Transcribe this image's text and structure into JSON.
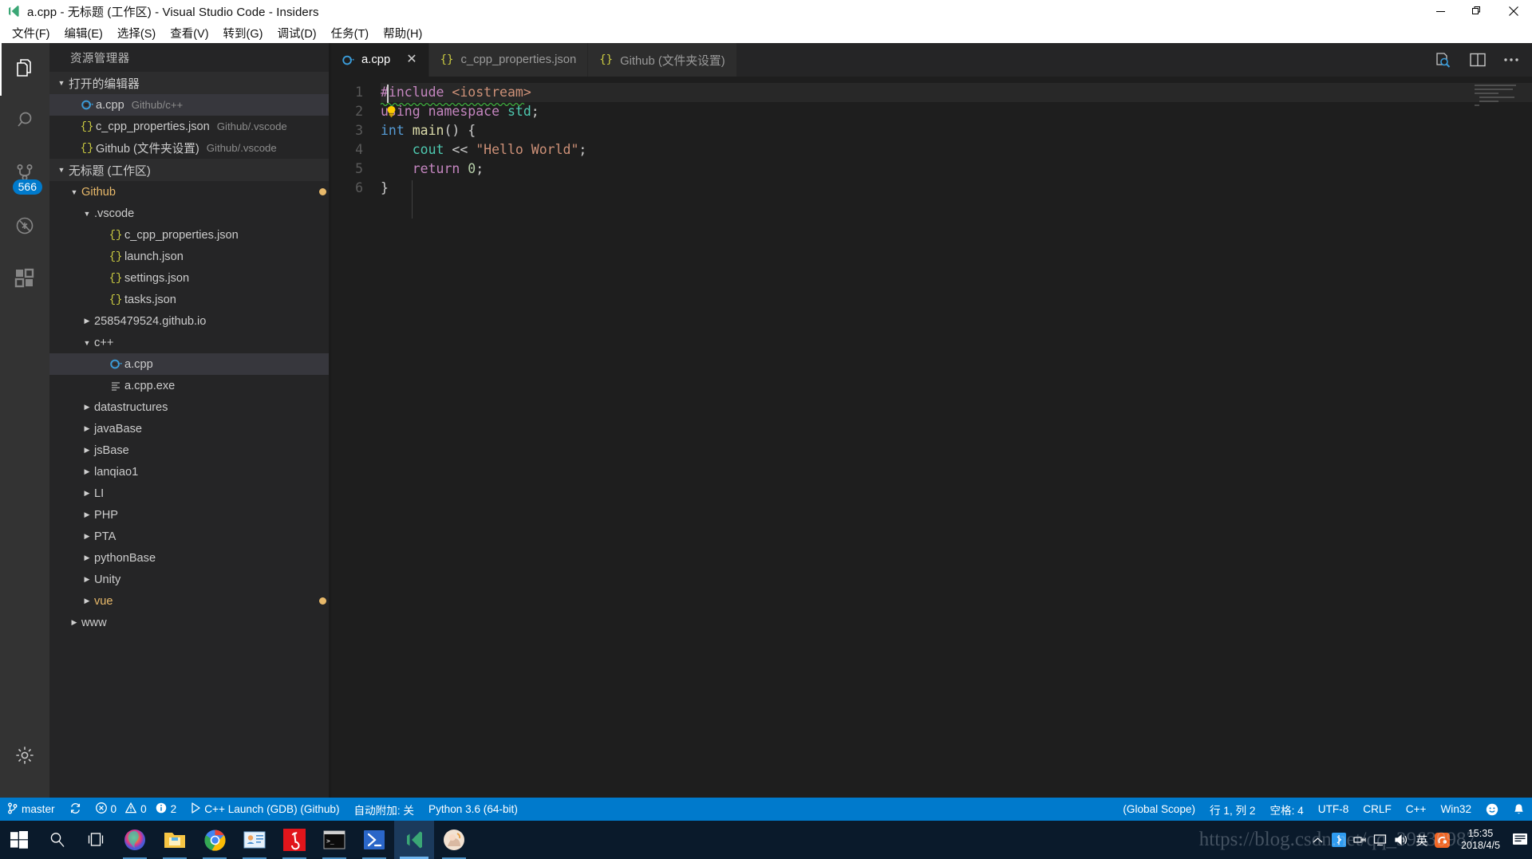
{
  "window": {
    "title": "a.cpp - 无标题 (工作区) - Visual Studio Code - Insiders",
    "minimize_label": "−",
    "restore_label": "❐",
    "close_label": "✕"
  },
  "menubar": {
    "items": [
      {
        "label": "文件(F)"
      },
      {
        "label": "编辑(E)"
      },
      {
        "label": "选择(S)"
      },
      {
        "label": "查看(V)"
      },
      {
        "label": "转到(G)"
      },
      {
        "label": "调试(D)"
      },
      {
        "label": "任务(T)"
      },
      {
        "label": "帮助(H)"
      }
    ]
  },
  "activitybar": {
    "items": [
      {
        "name": "explorer-icon",
        "label": "资源管理器",
        "active": true
      },
      {
        "name": "search-icon",
        "label": "搜索",
        "active": false
      },
      {
        "name": "source-control-icon",
        "label": "源代码管理",
        "active": false,
        "badge": "566"
      },
      {
        "name": "debug-icon",
        "label": "调试",
        "active": false
      },
      {
        "name": "extensions-icon",
        "label": "扩展",
        "active": false
      }
    ],
    "settings": {
      "name": "gear-icon",
      "label": "管理"
    }
  },
  "sidebar": {
    "title": "资源管理器",
    "open_editors": {
      "header": "打开的编辑器",
      "items": [
        {
          "name": "a.cpp",
          "path": "Github/c++",
          "icon": "cpp",
          "selected": true
        },
        {
          "name": "c_cpp_properties.json",
          "path": "Github/.vscode",
          "icon": "json",
          "selected": false
        },
        {
          "name": "Github (文件夹设置)",
          "path": "Github/.vscode",
          "icon": "json",
          "selected": false
        }
      ]
    },
    "workspace": {
      "header": "无标题 (工作区)",
      "tree": [
        {
          "label": "Github",
          "depth": 1,
          "type": "folder",
          "expanded": true,
          "color": "gold",
          "dirty": true
        },
        {
          "label": ".vscode",
          "depth": 2,
          "type": "folder",
          "expanded": true
        },
        {
          "label": "c_cpp_properties.json",
          "depth": 3,
          "type": "json"
        },
        {
          "label": "launch.json",
          "depth": 3,
          "type": "json"
        },
        {
          "label": "settings.json",
          "depth": 3,
          "type": "json"
        },
        {
          "label": "tasks.json",
          "depth": 3,
          "type": "json"
        },
        {
          "label": "2585479524.github.io",
          "depth": 2,
          "type": "folder",
          "expanded": false
        },
        {
          "label": "c++",
          "depth": 2,
          "type": "folder",
          "expanded": true
        },
        {
          "label": "a.cpp",
          "depth": 3,
          "type": "cpp",
          "selected": true
        },
        {
          "label": "a.cpp.exe",
          "depth": 3,
          "type": "exe"
        },
        {
          "label": "datastructures",
          "depth": 2,
          "type": "folder",
          "expanded": false
        },
        {
          "label": "javaBase",
          "depth": 2,
          "type": "folder",
          "expanded": false
        },
        {
          "label": "jsBase",
          "depth": 2,
          "type": "folder",
          "expanded": false
        },
        {
          "label": "lanqiao1",
          "depth": 2,
          "type": "folder",
          "expanded": false
        },
        {
          "label": "LI",
          "depth": 2,
          "type": "folder",
          "expanded": false
        },
        {
          "label": "PHP",
          "depth": 2,
          "type": "folder",
          "expanded": false
        },
        {
          "label": "PTA",
          "depth": 2,
          "type": "folder",
          "expanded": false
        },
        {
          "label": "pythonBase",
          "depth": 2,
          "type": "folder",
          "expanded": false
        },
        {
          "label": "Unity",
          "depth": 2,
          "type": "folder",
          "expanded": false
        },
        {
          "label": "vue",
          "depth": 2,
          "type": "folder",
          "expanded": false,
          "color": "gold",
          "dirty": true
        },
        {
          "label": "www",
          "depth": 1,
          "type": "folder",
          "expanded": false
        }
      ]
    }
  },
  "editor": {
    "tabs": [
      {
        "label": "a.cpp",
        "icon": "cpp",
        "active": true,
        "closable": true
      },
      {
        "label": "c_cpp_properties.json",
        "icon": "json",
        "active": false,
        "closable": false
      },
      {
        "label": "Github (文件夹设置)",
        "icon": "json",
        "active": false,
        "closable": false
      }
    ],
    "actions": [
      {
        "name": "open-preview-icon",
        "label": "预览"
      },
      {
        "name": "split-editor-icon",
        "label": "拆分编辑器"
      },
      {
        "name": "more-actions-icon",
        "label": "更多操作..."
      }
    ],
    "lines": [
      {
        "number": "1",
        "text": "#include <iostream>",
        "squiggle": true,
        "current": true
      },
      {
        "number": "2",
        "text": "using namespace std;",
        "lightbulb": true
      },
      {
        "number": "3",
        "text": "int main() {"
      },
      {
        "number": "4",
        "text": "    cout << \"Hello World\";"
      },
      {
        "number": "5",
        "text": "    return 0;",
        "glyph": "breakpoint"
      },
      {
        "number": "6",
        "text": "}"
      }
    ]
  },
  "statusbar": {
    "left": [
      {
        "name": "branch-status",
        "icon": "branch",
        "label": "master"
      },
      {
        "name": "sync-status",
        "icon": "sync",
        "label": ""
      },
      {
        "name": "problems-status",
        "icon": "errors",
        "label": "0",
        "label2": "0",
        "label3": "2"
      },
      {
        "name": "launch-config-status",
        "icon": "play",
        "label": "C++ Launch (GDB) (Github)"
      },
      {
        "name": "auto-attach-status",
        "label": "自动附加: 关"
      },
      {
        "name": "python-interpreter-status",
        "label": "Python 3.6 (64-bit)"
      }
    ],
    "right": [
      {
        "name": "scope-status",
        "label": "(Global Scope)"
      },
      {
        "name": "cursor-position-status",
        "label": "行 1, 列 2"
      },
      {
        "name": "indentation-status",
        "label": "空格: 4"
      },
      {
        "name": "encoding-status",
        "label": "UTF-8"
      },
      {
        "name": "eol-status",
        "label": "CRLF"
      },
      {
        "name": "language-mode-status",
        "label": "C++"
      },
      {
        "name": "platform-status",
        "label": "Win32"
      },
      {
        "name": "feedback-smiley-status",
        "label": "☺"
      },
      {
        "name": "notifications-status",
        "label": "🔔"
      }
    ]
  },
  "taskbar": {
    "items": [
      {
        "name": "start-button",
        "label": "开始"
      },
      {
        "name": "search-taskbar-button",
        "label": "搜索"
      },
      {
        "name": "task-view-button",
        "label": "任务视图"
      },
      {
        "name": "firefox-taskbar-icon",
        "label": "Firefox"
      },
      {
        "name": "file-explorer-taskbar-icon",
        "label": "文件资源管理器"
      },
      {
        "name": "chrome-taskbar-icon",
        "label": "Google Chrome"
      },
      {
        "name": "contacts-taskbar-icon",
        "label": "通讯录"
      },
      {
        "name": "netease-music-taskbar-icon",
        "label": "网易云音乐"
      },
      {
        "name": "terminal-taskbar-icon",
        "label": "命令提示符"
      },
      {
        "name": "powershell-taskbar-icon",
        "label": "PowerShell"
      },
      {
        "name": "vscode-taskbar-icon",
        "label": "Visual Studio Code - Insiders"
      },
      {
        "name": "photos-taskbar-icon",
        "label": "照片"
      }
    ],
    "tray": {
      "chevron": "︿",
      "ime": "英",
      "time": "15:35",
      "date": "2018/4/5"
    },
    "watermark": "https://blog.csdn.net/qq_39630987"
  },
  "colors": {
    "accent": "#007acc",
    "titlebar_bg": "#ffffff",
    "sidebar_bg": "#252526",
    "editor_bg": "#1e1e1e",
    "activitybar_bg": "#333333",
    "folder_gold": "#e8b96a",
    "taskbar_bg": "#0a1a2b"
  }
}
